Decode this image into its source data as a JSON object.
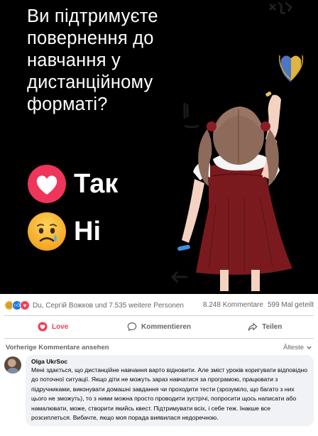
{
  "image": {
    "headline": "Ви підтримуєте повернення до навчання у дистанційному форматі?",
    "vote_yes": "Так",
    "vote_no": "Ні"
  },
  "summary": {
    "names": "Du, Сергій Вожков und 7.535 weitere Personen",
    "comments": "8.248 Kommentare",
    "shares": "599 Mal geteilt",
    "reactions": [
      "sad-reaction-icon",
      "like-reaction-icon",
      "love-reaction-icon"
    ]
  },
  "actions": {
    "love": "Love",
    "comment": "Kommentieren",
    "share": "Teilen"
  },
  "comments_header": {
    "previous": "Vorherige Kommentare ansehen",
    "sort": "Älteste"
  },
  "comment": {
    "author": "Olga UkrSoc",
    "text": "Мені здається, що дистанційне навчання варто відновити. Але зміст уроків коригувати відповідно до поточної ситуації. Якщо діти не можуть зараз навчатися за програмою, працювати з підручниками, виконувати домашні завдання чи проходити тести (зрозуміло, що багато з них цього не зможуть), то з ними можна просто проводити зустрічі, попросити щось написати або намалювати, може, створити якийсь квест. Підтримувати всіх, і себе теж. Інакше все розсиплеться. Вибачте, якщо моя порада виявилася недоречною."
  },
  "colors": {
    "love": "#f33e58",
    "like": "#1877f2",
    "muted": "#65676b",
    "bubble": "#f0f2f5",
    "dress": "#7a1a1f"
  }
}
